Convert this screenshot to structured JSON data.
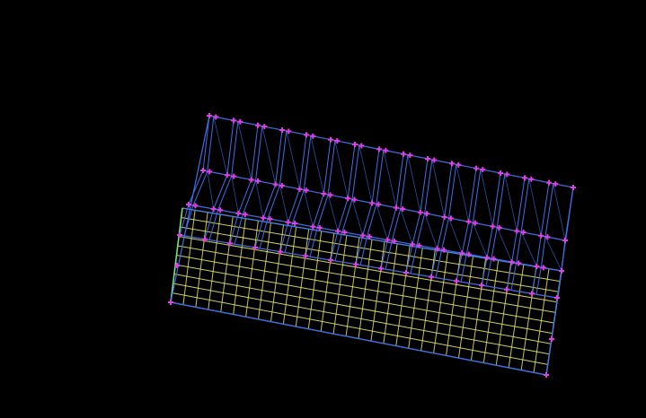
{
  "colors": {
    "background": "#000000",
    "wire": "#3f6fe8",
    "mesh": "#e6e66a",
    "mesh_edge": "#3d86f0",
    "node": "#e040e8",
    "accent": "#7ee27a"
  },
  "structure": {
    "bays": 15,
    "upper_levels": 3,
    "mesh_rows": 10,
    "mesh_cols": 30
  }
}
